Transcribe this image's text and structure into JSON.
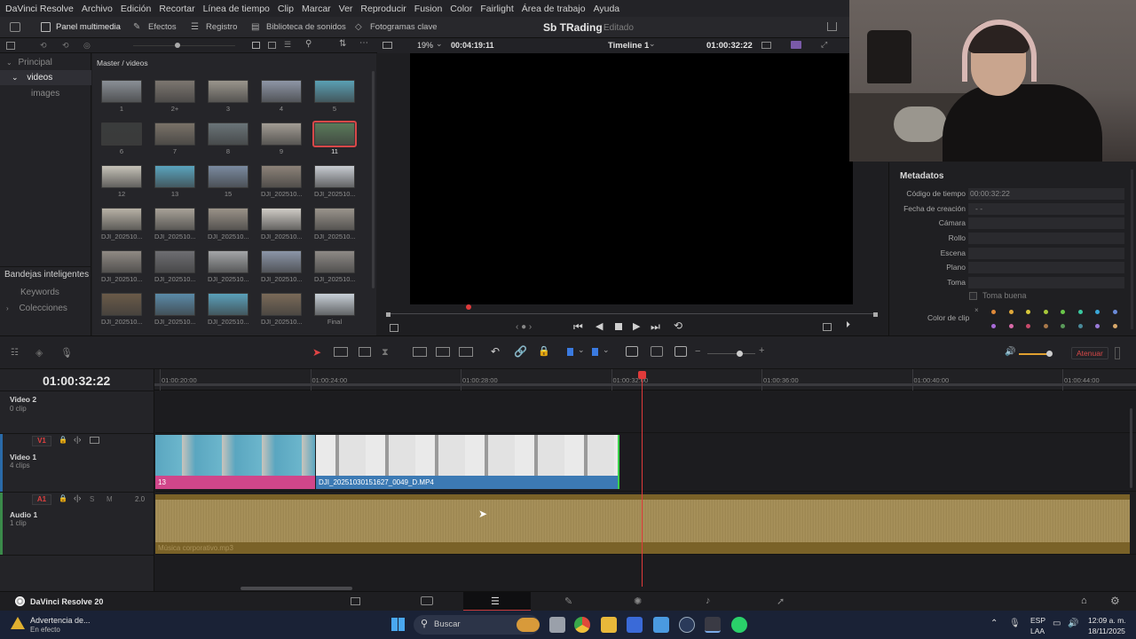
{
  "menubar": {
    "app_name": "DaVinci Resolve",
    "items": [
      "Archivo",
      "Edición",
      "Recortar",
      "Línea de tiempo",
      "Clip",
      "Marcar",
      "Ver",
      "Reproducir",
      "Fusion",
      "Color",
      "Fairlight",
      "Área de trabajo",
      "Ayuda"
    ]
  },
  "toolbar": {
    "media_pool": "Panel multimedia",
    "effects": "Efectos",
    "edit_index": "Registro",
    "sound_library": "Biblioteca de sonidos",
    "keyframes": "Fotogramas clave"
  },
  "project": {
    "title": "Sb TRading",
    "status": "Editado"
  },
  "viewer": {
    "zoom": "19%",
    "duration": "00:04:19:11",
    "timeline_name": "Timeline 1",
    "timecode": "01:00:32:22"
  },
  "sidebar": {
    "root": "Principal",
    "folder": "videos",
    "subfolder": "images",
    "smart_bins_title": "Bandejas inteligentes",
    "keywords": "Keywords",
    "collections": "Colecciones"
  },
  "media_pool": {
    "breadcrumb": "Master / videos",
    "clips": [
      {
        "label": "1",
        "color": "#8a8f96"
      },
      {
        "label": "2+",
        "color": "#7c7670"
      },
      {
        "label": "3",
        "color": "#9a958c"
      },
      {
        "label": "4",
        "color": "#8e96a6"
      },
      {
        "label": "5",
        "color": "#5aa0b4"
      },
      {
        "label": "6",
        "color": "#3a3c3c"
      },
      {
        "label": "7",
        "color": "#7a7268"
      },
      {
        "label": "8",
        "color": "#6a7478"
      },
      {
        "label": "9",
        "color": "#a39d94"
      },
      {
        "label": "11",
        "color": "#5a7a5a"
      },
      {
        "label": "12",
        "color": "#c6c2b8"
      },
      {
        "label": "13",
        "color": "#5aa4be"
      },
      {
        "label": "15",
        "color": "#7a8aa0"
      },
      {
        "label": "DJI_202510...",
        "color": "#8c8278"
      },
      {
        "label": "DJI_202510...",
        "color": "#c8ccd2"
      },
      {
        "label": "DJI_202510...",
        "color": "#b8b2a6"
      },
      {
        "label": "DJI_202510...",
        "color": "#a8a298"
      },
      {
        "label": "DJI_202510...",
        "color": "#9a9288"
      },
      {
        "label": "DJI_202510...",
        "color": "#d0ccc6"
      },
      {
        "label": "DJI_202510...",
        "color": "#9a948c"
      },
      {
        "label": "DJI_202510...",
        "color": "#908a84"
      },
      {
        "label": "DJI_202510...",
        "color": "#6e6e72"
      },
      {
        "label": "DJI_202510...",
        "color": "#a4a6a8"
      },
      {
        "label": "DJI_202510...",
        "color": "#8c96a8"
      },
      {
        "label": "DJI_202510...",
        "color": "#8e8a86"
      },
      {
        "label": "DJI_202510...",
        "color": "#6a5a48"
      },
      {
        "label": "DJI_202510...",
        "color": "#5a8aa8"
      },
      {
        "label": "DJI_202510...",
        "color": "#5aa0ba"
      },
      {
        "label": "DJI_202510...",
        "color": "#7a6a58"
      },
      {
        "label": "Final",
        "color": "#c8d0d8"
      }
    ],
    "selected_index": 9
  },
  "metadata": {
    "title": "Metadatos",
    "fields": [
      {
        "label": "Código de tiempo",
        "value": "00:00:32:22"
      },
      {
        "label": "Fecha de creación",
        "value": "- -"
      },
      {
        "label": "Cámara",
        "value": ""
      },
      {
        "label": "Rollo",
        "value": ""
      },
      {
        "label": "Escena",
        "value": ""
      },
      {
        "label": "Plano",
        "value": ""
      },
      {
        "label": "Toma",
        "value": ""
      }
    ],
    "good_take": "Toma buena",
    "clip_color": "Color de clip",
    "swatches": [
      "#e08a3a",
      "#e0a83a",
      "#d8c83a",
      "#a8c83a",
      "#6ac84a",
      "#3ac8a0",
      "#3aa8d8",
      "#6a8ad8",
      "#a86ad8",
      "#d86aa8",
      "#c84a6a",
      "#a8784a",
      "#5a9a5a",
      "#4a8a9a",
      "#9a7ad8",
      "#d8a86a"
    ]
  },
  "edit_toolbar": {
    "dim_label": "Atenuar"
  },
  "timeline": {
    "timecode": "01:00:32:22",
    "ruler_labels": [
      "01:00:20:00",
      "01:00:24:00",
      "01:00:28:00",
      "01:00:32:00",
      "01:00:36:00",
      "01:00:40:00",
      "01:00:44:00"
    ],
    "tracks": {
      "v2": {
        "name": "Video 2",
        "clips": "0 clip"
      },
      "v1": {
        "tag": "V1",
        "name": "Video 1",
        "clips": "4 clips"
      },
      "a1": {
        "tag": "A1",
        "name": "Audio 1",
        "clips": "1 clip",
        "level": "2.0",
        "solo": "S",
        "mute": "M"
      }
    },
    "clip_a_label": "13",
    "clip_b_label": "DJI_20251030151627_0049_D.MP4",
    "audio_label": "Música corporativo.mp3"
  },
  "bottom_bar": {
    "brand": "DaVinci Resolve 20"
  },
  "taskbar": {
    "notification_title": "Advertencia de...",
    "notification_sub": "En efecto",
    "search": "Buscar",
    "lang1": "ESP",
    "lang2": "LAA",
    "time": "12:09 a. m.",
    "date": "18/11/2025"
  }
}
